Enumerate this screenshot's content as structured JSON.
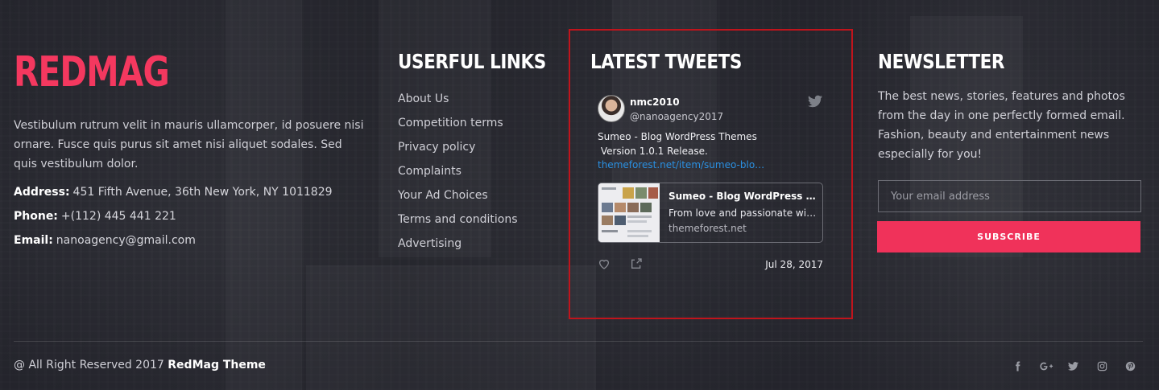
{
  "brand": {
    "logo_text": "REDMAG"
  },
  "about": {
    "description": "Vestibulum rutrum velit in mauris ullamcorper, id posuere nisi ornare. Fusce quis purus sit amet nisi aliquet sodales. Sed quis vestibulum dolor.",
    "address_label": "Address:",
    "address_value": "451 Fifth Avenue, 36th New York, NY 1011829",
    "phone_label": "Phone:",
    "phone_value": "+(112) 445 441 221",
    "email_label": "Email:",
    "email_value": "nanoagency@gmail.com"
  },
  "links": {
    "heading": "USERFUL LINKS",
    "items": [
      "About Us",
      "Competition terms",
      "Privacy policy",
      "Complaints",
      "Your Ad Choices",
      "Terms and conditions",
      "Advertising"
    ]
  },
  "tweets": {
    "heading": "LATEST TWEETS",
    "name": "nmc2010",
    "handle": "@nanoagency2017",
    "text": "Sumeo - Blog WordPress Themes\n Version 1.0.1 Release.",
    "link": "themeforest.net/item/sumeo-blo…",
    "card_title": "Sumeo - Blog WordPress The…",
    "card_desc": "From love and passionate with …",
    "card_domain": "themeforest.net",
    "date": "Jul 28, 2017",
    "icons": {
      "bird": "twitter-bird-icon",
      "like": "heart-icon",
      "share": "share-icon"
    }
  },
  "newsletter": {
    "heading": "NEWSLETTER",
    "text": "The best news, stories, features and photos from the day in one perfectly formed email. Fashion, beauty and entertainment news especially for you!",
    "email_placeholder": "Your email address",
    "email_value": "",
    "subscribe_label": "SUBSCRIBE"
  },
  "footer": {
    "copyright_prefix": "@ All Right Reserved 2017 ",
    "copyright_brand": "RedMag Theme",
    "social_icons": [
      "facebook-icon",
      "google-plus-icon",
      "twitter-icon",
      "instagram-icon",
      "pinterest-icon"
    ]
  },
  "colors": {
    "accent": "#f0325a",
    "brand": "#f4385f",
    "highlight_border": "#c0141c",
    "link": "#2a8fe0"
  }
}
